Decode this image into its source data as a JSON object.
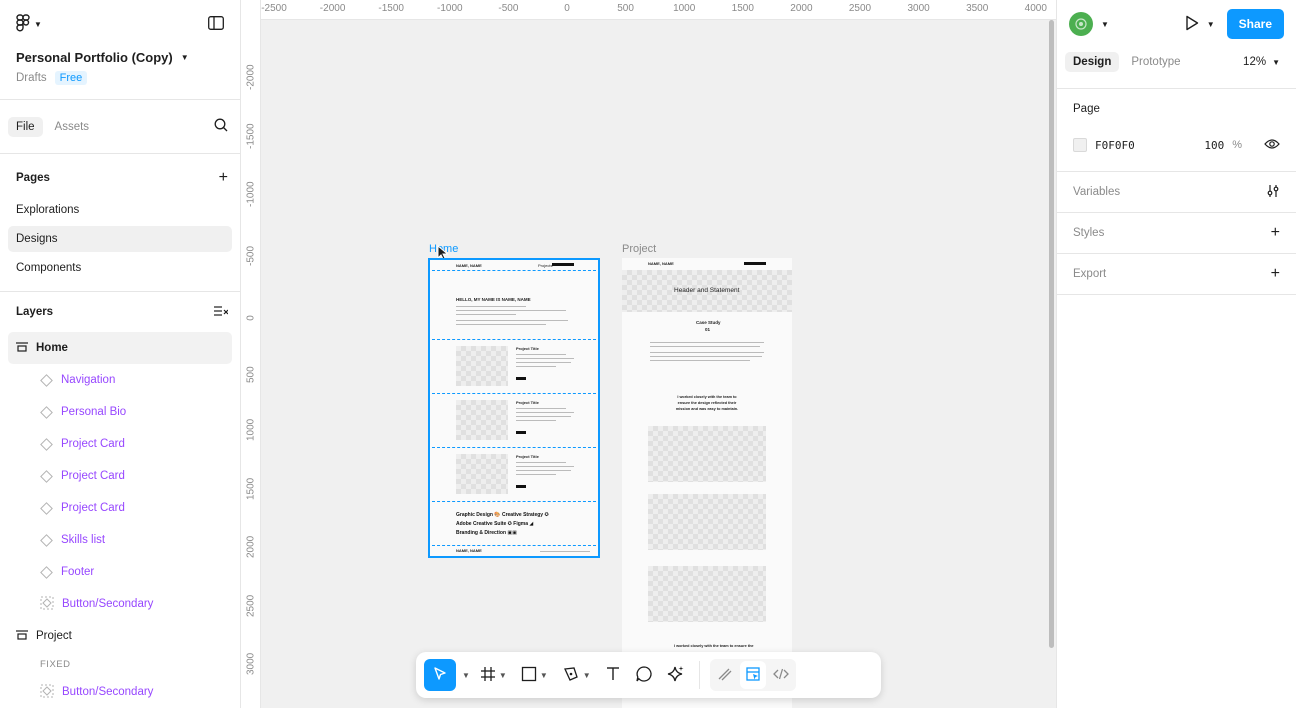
{
  "file": {
    "title": "Personal Portfolio (Copy)",
    "location": "Drafts",
    "plan": "Free"
  },
  "left_tabs": {
    "file": "File",
    "assets": "Assets"
  },
  "pages": {
    "heading": "Pages",
    "items": [
      "Explorations",
      "Designs",
      "Components"
    ]
  },
  "layers": {
    "heading": "Layers",
    "home": "Home",
    "home_children": [
      "Navigation",
      "Personal Bio",
      "Project Card",
      "Project Card",
      "Project Card",
      "Skills list",
      "Footer",
      "Button/Secondary"
    ],
    "project": "Project",
    "fixed_label": "FIXED",
    "project_children": [
      "Button/Secondary"
    ]
  },
  "rulers": {
    "top": [
      "-2500",
      "-2000",
      "-1500",
      "-1000",
      "-500",
      "0",
      "500",
      "1000",
      "1500",
      "2000",
      "2500",
      "3000",
      "3500",
      "4000"
    ],
    "left": [
      "-2000",
      "-1500",
      "-1000",
      "-500",
      "0",
      "500",
      "1000",
      "1500",
      "2000",
      "2500",
      "3000"
    ]
  },
  "canvas": {
    "frame_home_label": "Home",
    "frame_project_label": "Project",
    "home": {
      "nav_name": "NAME, NAME",
      "nav_link": "Projects",
      "bio_heading": "HELLO, MY NAME IS NAME, NAME",
      "card_title": "Project Title",
      "skills": [
        "Graphic Design 🎨 Creative Strategy ✪",
        "Adobe Creative Suite ✪ Figma ◢",
        "Branding & Direction ▣▣"
      ],
      "footer_name": "NAME, NAME"
    },
    "project": {
      "nav_name": "NAME, NAME",
      "header": "Header and Statement",
      "case_study": "Case Study",
      "case_number": "01",
      "quote": "I worked closely with the team to ensure the design reflected their mission and was easy to maintain.",
      "quote_bottom": "I worked closely with the team to ensure the"
    }
  },
  "right": {
    "tabs": {
      "design": "Design",
      "prototype": "Prototype"
    },
    "zoom": "12%",
    "share": "Share",
    "page_heading": "Page",
    "page_color": "F0F0F0",
    "page_opacity": "100",
    "page_opacity_unit": "%",
    "variables": "Variables",
    "styles": "Styles",
    "export": "Export"
  },
  "help": "?",
  "colors": {
    "accent": "#0d99ff",
    "component": "#9747ff",
    "canvas_bg": "#f0f0f0"
  }
}
